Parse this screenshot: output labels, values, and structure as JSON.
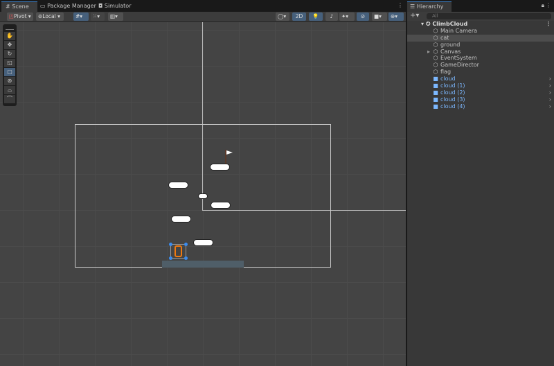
{
  "tabs": [
    {
      "label": "Scene",
      "icon": "grid-icon"
    },
    {
      "label": "Package Manager",
      "icon": "package-icon"
    },
    {
      "label": "Simulator",
      "icon": "simulator-icon"
    }
  ],
  "toolbar": {
    "pivot": "Pivot",
    "local": "Local",
    "mode_2d": "2D"
  },
  "tools": [
    "view",
    "move",
    "rotate",
    "scale",
    "rect",
    "transform",
    "custom1",
    "custom2"
  ],
  "hierarchy": {
    "title": "Hierarchy",
    "search_placeholder": "All",
    "scene": "ClimbCloud",
    "items": [
      {
        "label": "Main Camera",
        "prefab": false
      },
      {
        "label": "cat",
        "prefab": false,
        "selected": true
      },
      {
        "label": "ground",
        "prefab": false
      },
      {
        "label": "Canvas",
        "prefab": false,
        "expandable": true
      },
      {
        "label": "EventSystem",
        "prefab": false
      },
      {
        "label": "GameDirector",
        "prefab": false
      },
      {
        "label": "flag",
        "prefab": false
      },
      {
        "label": "cloud",
        "prefab": true
      },
      {
        "label": "cloud (1)",
        "prefab": true
      },
      {
        "label": "cloud (2)",
        "prefab": true
      },
      {
        "label": "cloud (3)",
        "prefab": true
      },
      {
        "label": "cloud (4)",
        "prefab": true
      }
    ]
  }
}
